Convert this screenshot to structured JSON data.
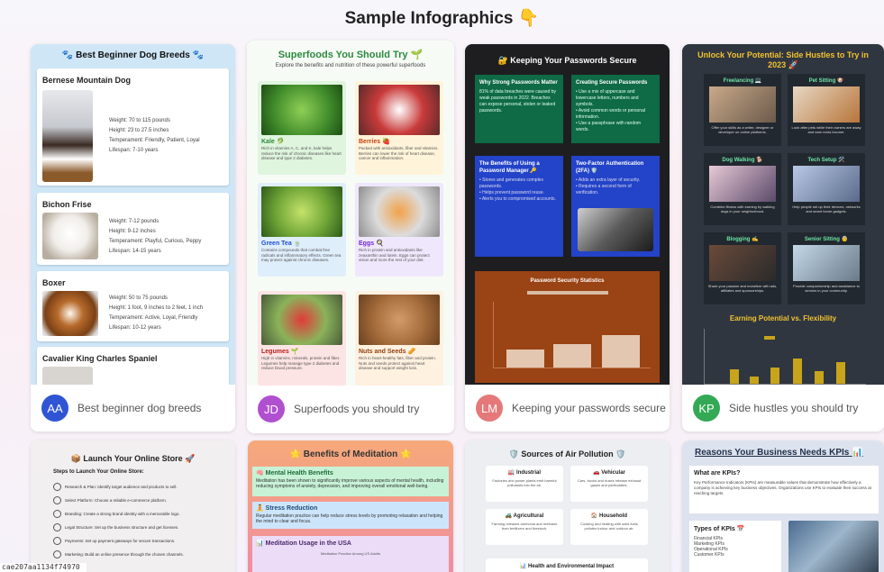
{
  "page_title": "Sample Infographics 👇",
  "cards": [
    {
      "avatar": "AA",
      "avatar_color": "#2f55d4",
      "caption": "Best beginner dog breeds"
    },
    {
      "avatar": "JD",
      "avatar_color": "#b04fd0",
      "caption": "Superfoods you should try"
    },
    {
      "avatar": "LM",
      "avatar_color": "#e5797a",
      "caption": "Keeping your passwords secure"
    },
    {
      "avatar": "KP",
      "avatar_color": "#33a855",
      "caption": "Side hustles you should try"
    }
  ],
  "dogs": {
    "title": "🐾 Best Beginner Dog Breeds 🐾",
    "breeds": [
      {
        "name": "Bernese Mountain Dog",
        "weight": "Weight: 70 to 115 pounds",
        "height": "Height: 23 to 27.5 inches",
        "temperament": "Temperament: Friendly, Patient, Loyal",
        "lifespan": "Lifespan: 7-10 years"
      },
      {
        "name": "Bichon Frise",
        "weight": "Weight: 7-12 pounds",
        "height": "Height: 9-12 inches",
        "temperament": "Temperament: Playful, Curious, Peppy",
        "lifespan": "Lifespan: 14-15 years"
      },
      {
        "name": "Boxer",
        "weight": "Weight: 50 to 75 pounds",
        "height": "Height: 1 foot, 9 inches to 2 feet, 1 inch",
        "temperament": "Temperament: Active, Loyal, Friendly",
        "lifespan": "Lifespan: 10-12 years"
      },
      {
        "name": "Cavalier King Charles Spaniel"
      }
    ]
  },
  "superfoods": {
    "title": "Superfoods You Should Try 🌱",
    "subtitle": "Explore the benefits and nutrition of these powerful superfoods",
    "items": [
      {
        "name": "Kale 🥬",
        "desc": "Rich in vitamins A, C, and K, kale helps reduce the risk of chronic diseases like heart disease and type 2 diabetes."
      },
      {
        "name": "Berries 🍓",
        "desc": "Packed with antioxidants, fiber and vitamins. Berries can lower the risk of heart disease, cancer and inflammation."
      },
      {
        "name": "Green Tea 🍵",
        "desc": "Contains compounds that combat free radicals and inflammatory effects. Green tea may protect against chronic diseases."
      },
      {
        "name": "Eggs 🍳",
        "desc": "Rich in protein and antioxidants like zeaxanthin and lutein. Eggs can protect vision and more the rest of your diet."
      },
      {
        "name": "Legumes 🌱",
        "desc": "High in vitamins, minerals, protein and fiber. Legumes help manage type 2 diabetes and reduce blood pressure."
      },
      {
        "name": "Nuts and Seeds 🥜",
        "desc": "Rich in heart-healthy fats, fiber and protein. Nuts and seeds protect against heart disease and support weight loss."
      }
    ]
  },
  "passwords": {
    "title": "🔐 Keeping Your Passwords Secure",
    "boxes": [
      {
        "title": "Why Strong Passwords Matter",
        "text": "81% of data breaches were caused by weak passwords in 2022. Breaches can expose personal, stolen or leaked passwords."
      },
      {
        "title": "Creating Secure Passwords",
        "text": "• Use a mix of uppercase and lowercase letters, numbers and symbols.\n• Avoid common words or personal information.\n• Use a passphrase with random words."
      },
      {
        "title": "The Benefits of Using a Password Manager 🔑",
        "text": "• Stores and generates complex passwords.\n• Helps prevent password reuse.\n• Alerts you to compromised accounts."
      },
      {
        "title": "Two-Factor Authentication (2FA) 🛡️",
        "text": "• Adds an extra layer of security.\n• Requires a second form of verification."
      }
    ],
    "chart_title": "Password Security Statistics"
  },
  "hustles": {
    "title": "Unlock Your Potential: Side Hustles to Try in 2023 🚀",
    "items": [
      {
        "name": "Freelancing 💻",
        "text": "Offer your skills as a writer, designer or developer on online platforms."
      },
      {
        "name": "Pet Sitting 🐶",
        "text": "Look after pets while their owners are away and earn extra income."
      },
      {
        "name": "Dog Walking 🐕",
        "text": "Combine fitness with earning by walking dogs in your neighborhood."
      },
      {
        "name": "Tech Setup 🛠️",
        "text": "Help people set up their devices, networks and smart home gadgets."
      },
      {
        "name": "Blogging ✍️",
        "text": "Share your passion and monetize with ads, affiliates and sponsorships."
      },
      {
        "name": "Senior Sitting 👵",
        "text": "Provide companionship and assistance to seniors in your community."
      }
    ],
    "chart_title": "Earning Potential vs. Flexibility"
  },
  "store": {
    "title": "📦 Launch Your Online Store 🚀",
    "subtitle": "Steps to Launch Your Online Store:",
    "steps": [
      "Research & Plan: Identify target audience and products to sell.",
      "Select Platform: Choose a reliable e-commerce platform.",
      "Branding: Create a strong brand identity with a memorable logo.",
      "Legal Structure: Set up the business structure and get licenses.",
      "Payments: Set up payment gateways for secure transactions.",
      "Marketing: Build an online presence through the chosen channels."
    ]
  },
  "meditation": {
    "title": "🌟 Benefits of Meditation 🌟",
    "boxes": [
      {
        "title": "🧠 Mental Health Benefits",
        "text": "Meditation has been shown to significantly improve various aspects of mental health, including reducing symptoms of anxiety, depression, and improving overall emotional well-being."
      },
      {
        "title": "🧘 Stress Reduction",
        "text": "Regular meditation practice can help reduce stress levels by promoting relaxation and helping the mind to clear and focus."
      },
      {
        "title": "📊 Meditation Usage in the USA",
        "text": "Meditation Practice Among US Adults"
      }
    ]
  },
  "pollution": {
    "title": "🛡️ Sources of Air Pollution 🛡️",
    "sources": [
      {
        "name": "🏭 Industrial",
        "text": "Factories and power plants emit harmful pollutants into the air."
      },
      {
        "name": "🚗 Vehicular",
        "text": "Cars, trucks and buses release exhaust gases and particulates."
      },
      {
        "name": "🚜 Agricultural",
        "text": "Farming releases ammonia and methane from fertilizers and livestock."
      },
      {
        "name": "🏠 Household",
        "text": "Cooking and heating with solid fuels pollutes indoor and outdoor air."
      }
    ],
    "impact": "📊 Health and Environmental Impact"
  },
  "kpis": {
    "title": "Reasons Your Business Needs KPIs 📊",
    "what_title": "What are KPIs?",
    "what_text": "Key Performance Indicators (KPIs) are measurable values that demonstrate how effectively a company is achieving key business objectives. Organizations use KPIs to evaluate their success at reaching targets.",
    "types_title": "Types of KPIs 📅",
    "types": [
      "Financial KPIs",
      "Marketing KPIs",
      "Operational KPIs",
      "Customer KPIs"
    ]
  },
  "status_hash": "cae207aa1134f74970"
}
